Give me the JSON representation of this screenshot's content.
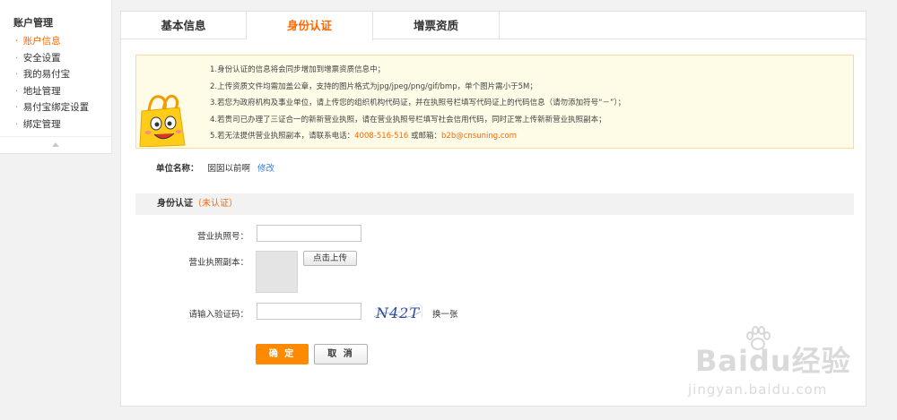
{
  "sidebar": {
    "title": "账户管理",
    "items": [
      {
        "label": "账户信息",
        "active": true
      },
      {
        "label": "安全设置",
        "active": false
      },
      {
        "label": "我的易付宝",
        "active": false
      },
      {
        "label": "地址管理",
        "active": false
      },
      {
        "label": "易付宝绑定设置",
        "active": false
      },
      {
        "label": "绑定管理",
        "active": false
      }
    ]
  },
  "tabs": [
    {
      "label": "基本信息",
      "active": false
    },
    {
      "label": "身份认证",
      "active": true
    },
    {
      "label": "增票资质",
      "active": false
    }
  ],
  "notice": {
    "items": [
      {
        "text": "1.身份认证的信息将会同步增加到增票资质信息中；"
      },
      {
        "text": "2.上传资质文件均需加盖公章，支持的图片格式为jpg/jpeg/png/gif/bmp，单个图片需小于5M；"
      },
      {
        "text": "3.若您为政府机构及事业单位，请上传您的组织机构代码证，并在执照号栏填写代码证上的代码信息（请勿添加符号“－”）；"
      },
      {
        "text": "4.若贵司已办理了三证合一的新新营业执照，请在营业执照号栏填写社会信用代码，同时正常上传新新营业执照副本；"
      },
      {
        "prefix": "5.若无法提供营业执照副本，请联系电话：",
        "phone": "4008-516-516",
        "mid": " 或邮箱：",
        "email": "b2b@cnsuning.com"
      }
    ]
  },
  "unit": {
    "label": "单位名称：",
    "value": "囡囡以前啊",
    "edit_label": "修改"
  },
  "section": {
    "title": "身份认证",
    "status": "（未认证）"
  },
  "form": {
    "license_no_label": "营业执照号：",
    "license_no_value": "",
    "license_copy_label": "营业执照副本：",
    "upload_button": "点击上传",
    "captcha_label": "请输入验证码：",
    "captcha_value": "",
    "captcha_text": "N42T",
    "captcha_refresh": "换一张",
    "ok_button": "确 定",
    "cancel_button": "取 消"
  },
  "watermark": {
    "brand": "Baidu经验",
    "url": "jingyan.baidu.com"
  },
  "colors": {
    "accent": "#ff6600",
    "primary_button": "#ff8a00",
    "link": "#3a7bd5",
    "notice_bg": "#fefbe6",
    "notice_border": "#f7dd93"
  }
}
